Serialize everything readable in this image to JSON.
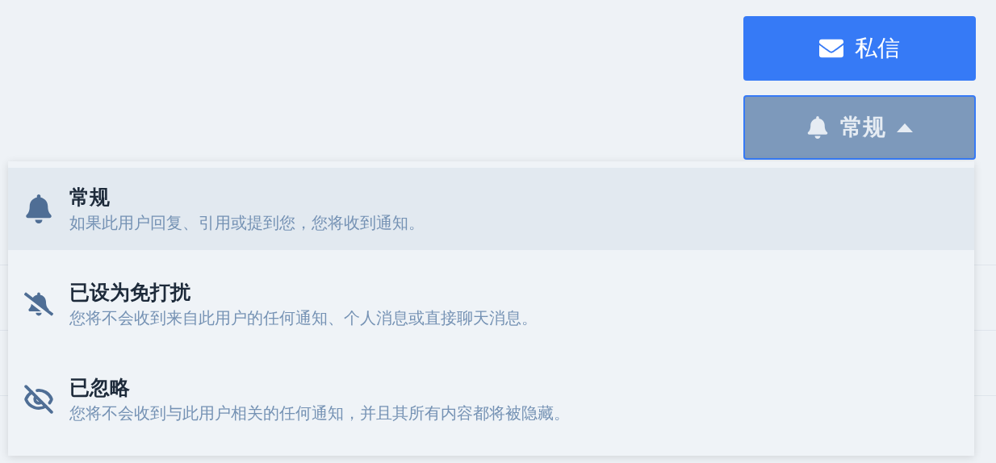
{
  "buttons": [
    {
      "kind": "message",
      "label": "私信"
    },
    {
      "kind": "notify",
      "label": "常规",
      "expanded": true
    }
  ],
  "menu": {
    "items": [
      {
        "kind": "normal",
        "title": "常规",
        "description": "如果此用户回复、引用或提到您，您将收到通知。",
        "selected": true
      },
      {
        "kind": "muted",
        "title": "已设为免打扰",
        "description": "您将不会收到来自此用户的任何通知、个人消息或直接聊天消息。",
        "selected": false
      },
      {
        "kind": "ignored",
        "title": "已忽略",
        "description": "您将不会收到与此用户相关的任何通知，并且其所有内容都将被隐藏。",
        "selected": false
      }
    ]
  }
}
